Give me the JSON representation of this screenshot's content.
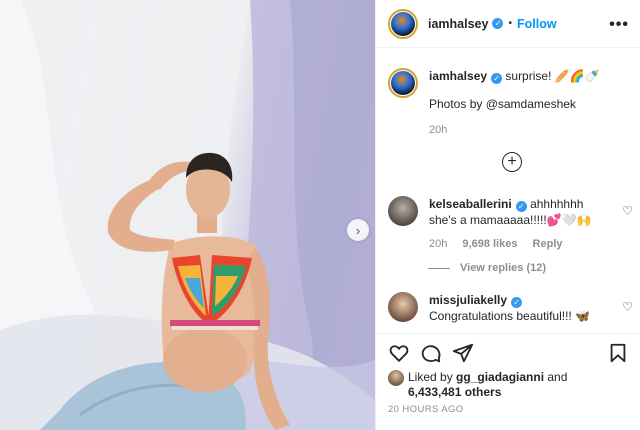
{
  "post": {
    "username": "iamhalsey",
    "follow_label": "Follow",
    "separator": "•",
    "more_label": "•••",
    "verified_glyph": "✓",
    "caption": "surprise! 🥖🌈🍼",
    "caption_line2_prefix": "Photos by ",
    "caption_mention": "@samdameshek",
    "caption_time": "20h",
    "load_more_glyph": "+",
    "next_glyph": "›"
  },
  "comments": [
    {
      "username": "kelseaballerini",
      "text": "ahhhhhhh she's a mamaaaaa!!!!!💕🤍🙌",
      "time": "20h",
      "likes": "9,698 likes",
      "reply_label": "Reply",
      "view_replies": "View replies (12)",
      "heart": "♡"
    },
    {
      "username": "missjuliakelly",
      "text": "Congratulations beautiful!!! 🦋",
      "heart": "♡"
    }
  ],
  "footer": {
    "liked_prefix": "Liked by ",
    "liked_user": "gg_giadagianni",
    "liked_and": " and",
    "liked_others": "6,433,481 others",
    "time_ago": "20 HOURS AGO"
  },
  "icons": {
    "like": "heart-outline-icon",
    "comment": "comment-bubble-icon",
    "share": "paper-plane-icon",
    "save": "bookmark-icon"
  },
  "colors": {
    "accent": "#0095f6",
    "verified": "#3897f0",
    "muted": "#8e8e8e",
    "text": "#262626"
  }
}
